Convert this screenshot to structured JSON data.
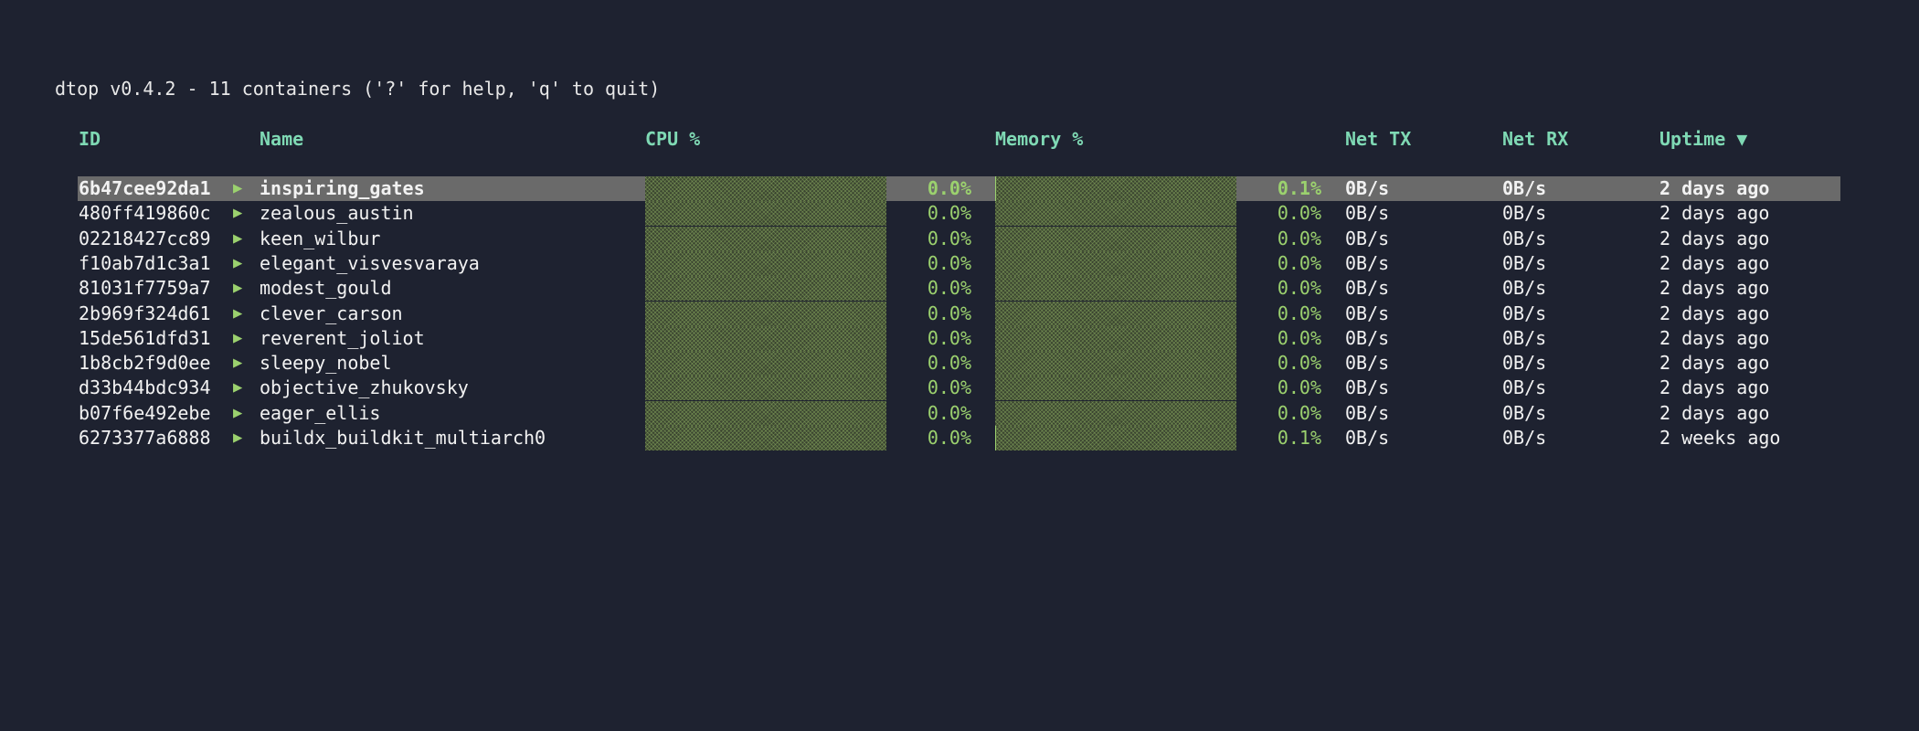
{
  "app": {
    "title_line": "dtop v0.4.2 - 11 containers ('?' for help, 'q' to quit)"
  },
  "colors": {
    "background": "#1e2230",
    "header": "#7fd9b4",
    "accent_green": "#9bd16e",
    "selected_row": "#6a6a6a"
  },
  "columns": {
    "id": "ID",
    "name": "Name",
    "cpu": "CPU %",
    "memory": "Memory %",
    "net_tx": "Net TX",
    "net_rx": "Net RX",
    "uptime": "Uptime ▼"
  },
  "status_icon": "play-triangle-icon",
  "status_glyph": "▶",
  "selected_index": 0,
  "containers": [
    {
      "id": "6b47cee92da1",
      "name": "inspiring_gates",
      "cpu": "0.0%",
      "cpu_value": 0.0,
      "mem": "0.1%",
      "mem_value": 0.1,
      "tx": "0B/s",
      "rx": "0B/s",
      "uptime": "2 days ago"
    },
    {
      "id": "480ff419860c",
      "name": "zealous_austin",
      "cpu": "0.0%",
      "cpu_value": 0.0,
      "mem": "0.0%",
      "mem_value": 0.0,
      "tx": "0B/s",
      "rx": "0B/s",
      "uptime": "2 days ago"
    },
    {
      "id": "02218427cc89",
      "name": "keen_wilbur",
      "cpu": "0.0%",
      "cpu_value": 0.0,
      "mem": "0.0%",
      "mem_value": 0.0,
      "tx": "0B/s",
      "rx": "0B/s",
      "uptime": "2 days ago"
    },
    {
      "id": "f10ab7d1c3a1",
      "name": "elegant_visvesvaraya",
      "cpu": "0.0%",
      "cpu_value": 0.0,
      "mem": "0.0%",
      "mem_value": 0.0,
      "tx": "0B/s",
      "rx": "0B/s",
      "uptime": "2 days ago"
    },
    {
      "id": "81031f7759a7",
      "name": "modest_gould",
      "cpu": "0.0%",
      "cpu_value": 0.0,
      "mem": "0.0%",
      "mem_value": 0.0,
      "tx": "0B/s",
      "rx": "0B/s",
      "uptime": "2 days ago"
    },
    {
      "id": "2b969f324d61",
      "name": "clever_carson",
      "cpu": "0.0%",
      "cpu_value": 0.0,
      "mem": "0.0%",
      "mem_value": 0.0,
      "tx": "0B/s",
      "rx": "0B/s",
      "uptime": "2 days ago"
    },
    {
      "id": "15de561dfd31",
      "name": "reverent_joliot",
      "cpu": "0.0%",
      "cpu_value": 0.0,
      "mem": "0.0%",
      "mem_value": 0.0,
      "tx": "0B/s",
      "rx": "0B/s",
      "uptime": "2 days ago"
    },
    {
      "id": "1b8cb2f9d0ee",
      "name": "sleepy_nobel",
      "cpu": "0.0%",
      "cpu_value": 0.0,
      "mem": "0.0%",
      "mem_value": 0.0,
      "tx": "0B/s",
      "rx": "0B/s",
      "uptime": "2 days ago"
    },
    {
      "id": "d33b44bdc934",
      "name": "objective_zhukovsky",
      "cpu": "0.0%",
      "cpu_value": 0.0,
      "mem": "0.0%",
      "mem_value": 0.0,
      "tx": "0B/s",
      "rx": "0B/s",
      "uptime": "2 days ago"
    },
    {
      "id": "b07f6e492ebe",
      "name": "eager_ellis",
      "cpu": "0.0%",
      "cpu_value": 0.0,
      "mem": "0.0%",
      "mem_value": 0.0,
      "tx": "0B/s",
      "rx": "0B/s",
      "uptime": "2 days ago"
    },
    {
      "id": "6273377a6888",
      "name": "buildx_buildkit_multiarch0",
      "cpu": "0.0%",
      "cpu_value": 0.0,
      "mem": "0.1%",
      "mem_value": 0.1,
      "tx": "0B/s",
      "rx": "0B/s",
      "uptime": "2 weeks ago"
    }
  ]
}
